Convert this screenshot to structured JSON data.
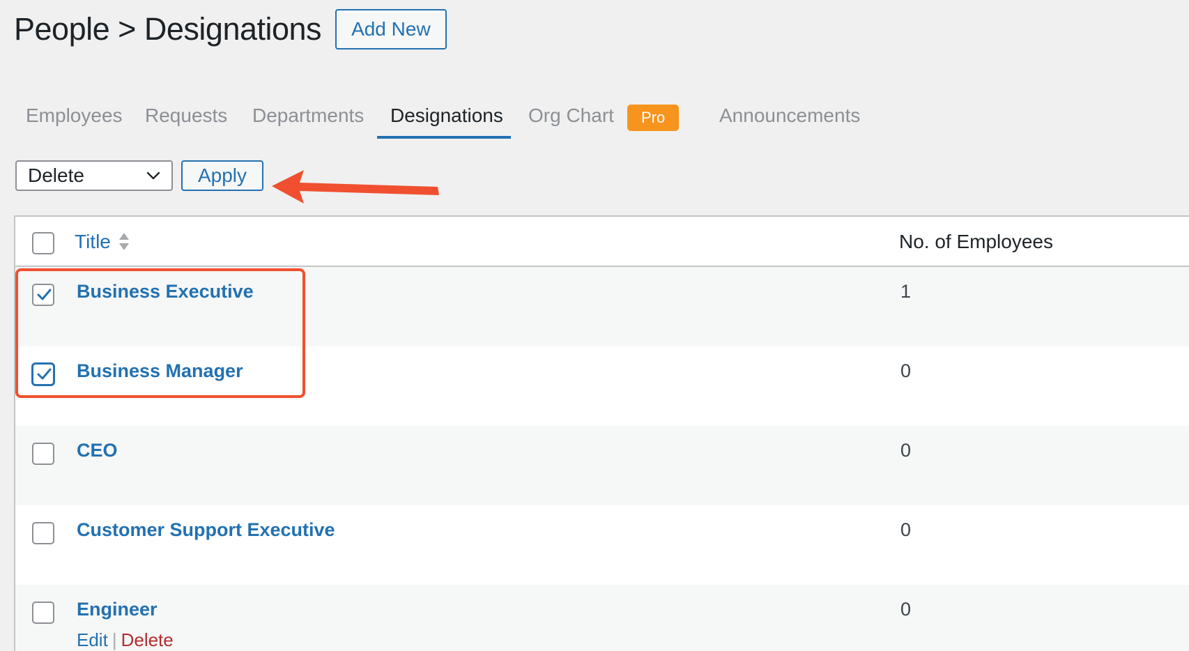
{
  "header": {
    "title": "People > Designations",
    "add_new_label": "Add New"
  },
  "tabs": [
    {
      "label": "Employees",
      "active": false
    },
    {
      "label": "Requests",
      "active": false
    },
    {
      "label": "Departments",
      "active": false
    },
    {
      "label": "Designations",
      "active": true
    },
    {
      "label": "Org Chart",
      "active": false,
      "badge": "Pro"
    },
    {
      "label": "Announcements",
      "active": false
    }
  ],
  "bulk_actions": {
    "selected": "Delete",
    "apply_label": "Apply"
  },
  "table": {
    "columns": [
      "Title",
      "No. of Employees"
    ],
    "rows": [
      {
        "title": "Business Executive",
        "count": "1",
        "checked": true
      },
      {
        "title": "Business Manager",
        "count": "0",
        "checked": true
      },
      {
        "title": "CEO",
        "count": "0",
        "checked": false
      },
      {
        "title": "Customer Support Executive",
        "count": "0",
        "checked": false
      },
      {
        "title": "Engineer",
        "count": "0",
        "checked": false,
        "actions": {
          "edit": "Edit",
          "separator": "|",
          "delete": "Delete"
        }
      }
    ]
  },
  "colors": {
    "accent": "#2271b1",
    "pro_badge": "#f7941d",
    "annotation": "#f0502f",
    "danger": "#b32d2e"
  }
}
